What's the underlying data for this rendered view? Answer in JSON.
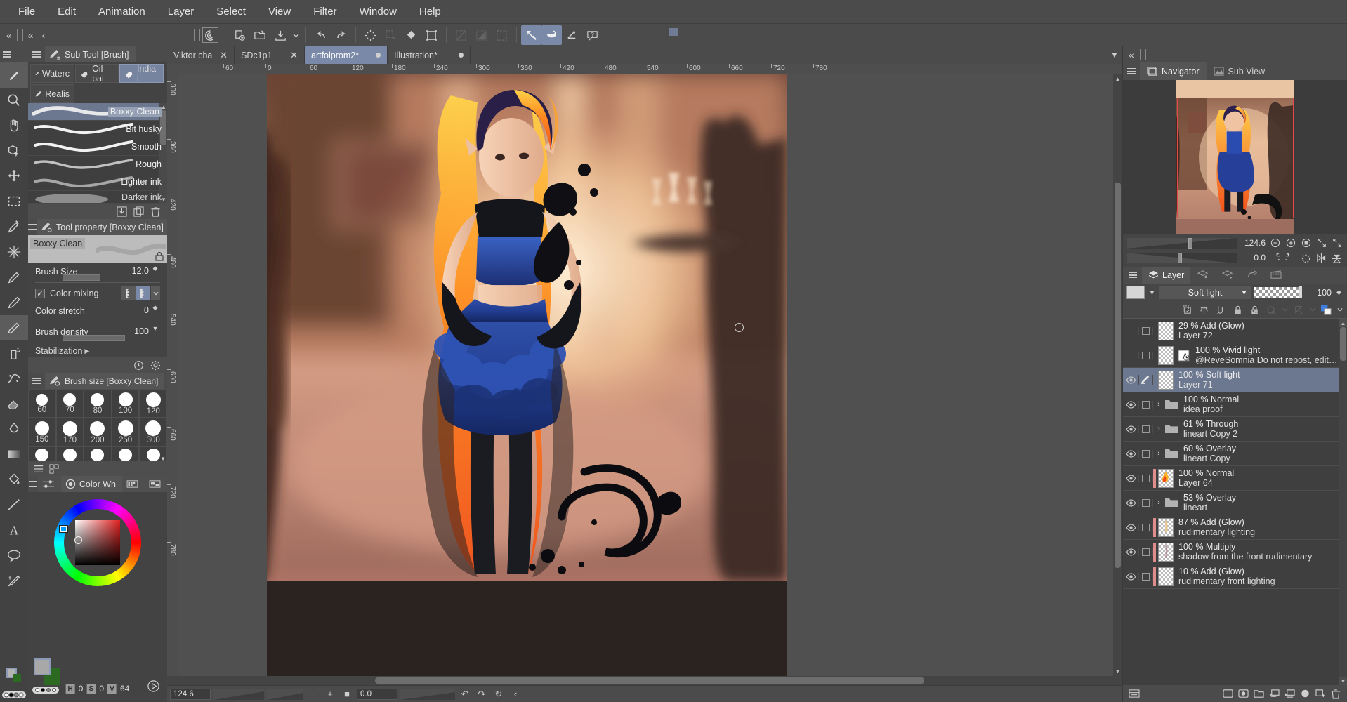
{
  "menubar": {
    "items": [
      "File",
      "Edit",
      "Animation",
      "Layer",
      "Select",
      "View",
      "Filter",
      "Window",
      "Help"
    ]
  },
  "command_bar": {
    "left_controls": [
      "collapse-all",
      "grip",
      "collapse",
      "back"
    ],
    "buttons": [
      {
        "name": "clip-studio-logo",
        "label": "logo"
      },
      {
        "name": "new-document",
        "label": "New"
      },
      {
        "name": "open-file",
        "label": "Open"
      },
      {
        "name": "save-file",
        "label": "Save"
      },
      {
        "name": "save-dropdown",
        "label": "v"
      },
      {
        "name": "undo",
        "label": "Undo"
      },
      {
        "name": "redo",
        "label": "Redo"
      },
      {
        "name": "clear",
        "label": "Clear"
      },
      {
        "name": "fill-selection",
        "label": "Fill selection"
      },
      {
        "name": "fill",
        "label": "Fill"
      },
      {
        "name": "scale-rotate",
        "label": "Scale/Rotate"
      },
      {
        "name": "deselect",
        "label": "Deselect"
      },
      {
        "name": "invert-selection",
        "label": "Invert"
      },
      {
        "name": "selection-border",
        "label": "Selection border"
      },
      {
        "name": "snap-to-ruler",
        "label": "Snap to special ruler"
      },
      {
        "name": "snap-to-grid",
        "label": "Snap to grid"
      },
      {
        "name": "snap-perspective",
        "label": "Snap to perspective"
      },
      {
        "name": "help",
        "label": "Help"
      }
    ]
  },
  "tool_column": {
    "tools": [
      {
        "name": "magnifier-tool",
        "label": "Magnifier"
      },
      {
        "name": "move-canvas-tool",
        "label": "Move canvas"
      },
      {
        "name": "rotate-3d-tool",
        "label": "Operation"
      },
      {
        "name": "move-layer-tool",
        "label": "Move layer"
      },
      {
        "name": "selection-tool",
        "label": "Selection area"
      },
      {
        "name": "eyedropper-tool",
        "label": "Eyedropper"
      },
      {
        "name": "auto-select-tool",
        "label": "Auto select"
      },
      {
        "name": "pen-tool",
        "label": "Pen"
      },
      {
        "name": "pencil-tool",
        "label": "Pencil"
      },
      {
        "name": "brush-tool",
        "label": "Brush"
      },
      {
        "name": "airbrush-tool",
        "label": "Airbrush"
      },
      {
        "name": "decoration-tool",
        "label": "Decoration"
      },
      {
        "name": "eraser-tool",
        "label": "Eraser"
      },
      {
        "name": "blend-tool",
        "label": "Blend"
      },
      {
        "name": "gradient-tool",
        "label": "Gradient"
      },
      {
        "name": "fill-tool",
        "label": "Fill"
      },
      {
        "name": "figure-tool",
        "label": "Figure"
      },
      {
        "name": "frame-border-tool",
        "label": "Frame border"
      },
      {
        "name": "text-tool",
        "label": "Text"
      },
      {
        "name": "balloon-tool",
        "label": "Balloon"
      },
      {
        "name": "correct-line-tool",
        "label": "Correct line"
      }
    ],
    "selected": "brush-tool"
  },
  "sub_tool_panel": {
    "title": "Sub Tool [Brush]",
    "categories": [
      {
        "label": "Waterc",
        "name": "watercolor",
        "active": false
      },
      {
        "label": "Oil pai",
        "name": "oil-paint",
        "active": false
      },
      {
        "label": "India i",
        "name": "india-ink",
        "active": true
      },
      {
        "label": "Realis",
        "name": "realistic",
        "active": false
      }
    ],
    "brushes": [
      {
        "name": "Boxxy Clean",
        "active": true
      },
      {
        "name": "Bit husky",
        "active": false
      },
      {
        "name": "Smooth",
        "active": false
      },
      {
        "name": "Rough",
        "active": false
      },
      {
        "name": "Lighter ink",
        "active": false
      },
      {
        "name": "Darker ink",
        "active": false
      }
    ],
    "footer_icons": [
      "import-sub-tool-icon",
      "duplicate-sub-tool-icon",
      "delete-sub-tool-icon"
    ]
  },
  "tool_property_panel": {
    "title": "Tool property [Boxxy Clean]",
    "preview_label": "Boxxy Clean",
    "lock_icon": "lock-icon",
    "rows": [
      {
        "label": "Brush Size",
        "value": "12.0",
        "name": "brush-size"
      },
      {
        "label": "Color stretch",
        "value": "0",
        "name": "color-stretch"
      },
      {
        "label": "Brush density",
        "value": "100",
        "name": "brush-density"
      }
    ],
    "color_mixing": {
      "label": "Color mixing",
      "checked": true
    },
    "stabilization": {
      "label": "Stabilization"
    },
    "footer_icons": [
      "clock-icon",
      "settings-icon"
    ]
  },
  "brush_size_panel": {
    "title": "Brush size [Boxxy Clean]",
    "sizes": [
      [
        "60",
        "70",
        "80",
        "100",
        "120"
      ],
      [
        "150",
        "170",
        "200",
        "250",
        "300"
      ],
      [
        "",
        "",
        "",
        "",
        ""
      ]
    ]
  },
  "color_panel": {
    "tabs": [
      {
        "label": "Color Wh",
        "name": "color-wheel",
        "active": true
      },
      {
        "label": "",
        "name": "color-slider",
        "active": false
      },
      {
        "label": "",
        "name": "color-set",
        "active": false
      }
    ],
    "hsv": {
      "h_label": "H",
      "h": "0",
      "s_label": "S",
      "s": "0",
      "v_label": "V",
      "v": "64"
    }
  },
  "document_tabs": {
    "tabs": [
      {
        "label": "Viktor character",
        "closable": true,
        "modified": false,
        "active": false
      },
      {
        "label": "SDc1p1",
        "closable": true,
        "modified": false,
        "active": false
      },
      {
        "label": "artfolprom2*",
        "closable": false,
        "modified": true,
        "active": true
      },
      {
        "label": "Illustration*",
        "closable": false,
        "modified": true,
        "active": false
      }
    ]
  },
  "canvas": {
    "h_ruler_labels": [
      "60",
      "0",
      "60",
      "120",
      "180",
      "240",
      "300",
      "360",
      "420",
      "480",
      "540",
      "600",
      "660",
      "720",
      "780"
    ],
    "v_ruler_labels": [
      "300",
      "360",
      "420",
      "480",
      "540",
      "600",
      "660",
      "720",
      "780"
    ]
  },
  "navigator": {
    "tabs": [
      {
        "label": "Navigator",
        "name": "navigator",
        "active": true
      },
      {
        "label": "Sub View",
        "name": "sub-view",
        "active": false
      }
    ],
    "zoom": "124.6",
    "rotation": "0.0",
    "zoom_controls": [
      "zoom-out-icon",
      "zoom-in-icon",
      "fit-icon",
      "fit-to-screen-icon",
      "actual-pixels-icon"
    ],
    "rotate_controls": [
      "rotate-left-icon",
      "rotate-right-icon",
      "reset-rotation-icon",
      "flip-horizontal-icon",
      "flip-vertical-icon"
    ]
  },
  "layer_panel": {
    "tabs": [
      {
        "label": "Layer",
        "name": "layer",
        "active": true
      },
      {
        "label": "",
        "name": "layer-property",
        "active": false
      },
      {
        "label": "",
        "name": "new-raster-layer",
        "active": false
      },
      {
        "label": "",
        "name": "history",
        "active": false
      },
      {
        "label": "",
        "name": "animation-cels",
        "active": false
      }
    ],
    "blend_mode": "Soft light",
    "opacity": "100",
    "lock_buttons": [
      "clip-to-layer-icon",
      "reference-layer-icon",
      "set-as-draft-icon",
      "lock-layer-icon",
      "lock-transparent-pixels-icon",
      "mask-enable-icon",
      "mask-area-icon",
      "palette-color-icon"
    ],
    "layers": [
      {
        "blend": "29 % Add (Glow)",
        "name": "Layer 72",
        "visible": false,
        "type": "raster",
        "selected": false,
        "has_bar": false,
        "thumb": "empty"
      },
      {
        "blend": "100 % Vivid light",
        "name": "@ReveSomnia Do not repost,   edit or use",
        "visible": false,
        "type": "text",
        "selected": false,
        "has_bar": false,
        "thumb": "text"
      },
      {
        "blend": "100 % Soft light",
        "name": "Layer 71",
        "visible": true,
        "type": "raster",
        "selected": true,
        "has_bar": false,
        "thumb": "empty"
      },
      {
        "blend": "100 % Normal",
        "name": "idea proof",
        "visible": true,
        "type": "folder",
        "selected": false,
        "has_bar": false,
        "thumb": "folder"
      },
      {
        "blend": "61 % Through",
        "name": "lineart Copy 2",
        "visible": true,
        "type": "folder",
        "selected": false,
        "has_bar": false,
        "thumb": "folder"
      },
      {
        "blend": "60 % Overlay",
        "name": "lineart Copy",
        "visible": true,
        "type": "folder",
        "selected": false,
        "has_bar": false,
        "thumb": "folder"
      },
      {
        "blend": "100 % Normal",
        "name": "Layer 64",
        "visible": true,
        "type": "raster",
        "selected": false,
        "has_bar": true,
        "thumb": "fire"
      },
      {
        "blend": "53 % Overlay",
        "name": "lineart",
        "visible": true,
        "type": "folder",
        "selected": false,
        "has_bar": false,
        "thumb": "folder"
      },
      {
        "blend": "87 % Add (Glow)",
        "name": "rudimentary lighting",
        "visible": true,
        "type": "raster",
        "selected": false,
        "has_bar": true,
        "thumb": "light"
      },
      {
        "blend": "100 % Multiply",
        "name": "shadow from the front rudimentary",
        "visible": true,
        "type": "raster",
        "selected": false,
        "has_bar": true,
        "thumb": "shadow"
      },
      {
        "blend": "10 % Add (Glow)",
        "name": "rudimentary  front lighting",
        "visible": true,
        "type": "raster",
        "selected": false,
        "has_bar": true,
        "thumb": "empty"
      }
    ],
    "footer_icons": [
      "layer-settings-icon",
      "new-raster-layer-icon",
      "new-tonal-layer-icon",
      "new-layer-folder-icon",
      "transfer-down-icon",
      "combine-down-icon",
      "layer-mask-icon",
      "clip-mask-icon",
      "delete-layer-icon"
    ]
  },
  "status_bar": {
    "zoom": "124.6",
    "rotation": "0.0",
    "buttons": [
      "zoom-out-icon",
      "zoom-in-icon",
      "fit-icon",
      "rotate-left-icon",
      "rotate-right-icon",
      "reset-rotation-icon",
      "collapse-icon"
    ]
  }
}
